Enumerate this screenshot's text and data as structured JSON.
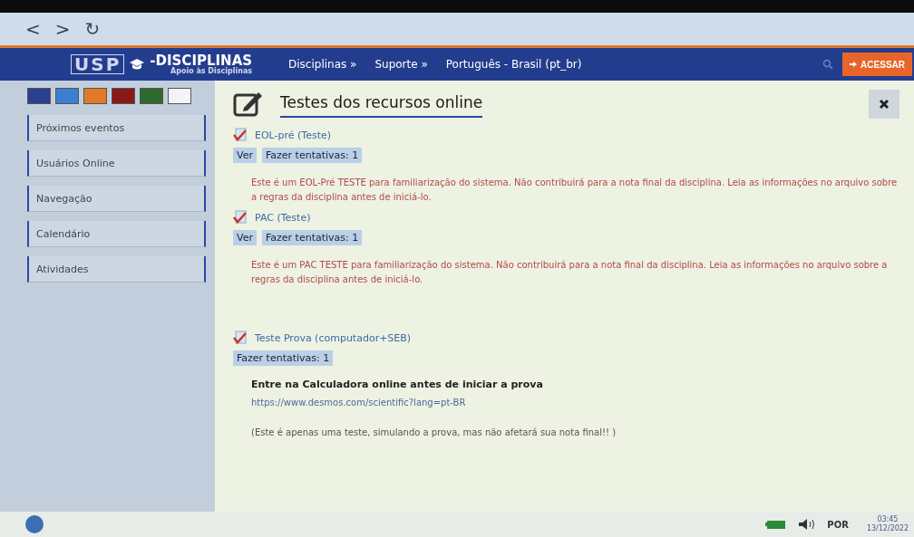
{
  "browser": {
    "nav": [
      "<",
      ">",
      "↻"
    ]
  },
  "header": {
    "logo": "USP",
    "brand": "-DISCIPLINAS",
    "tagline": "Apoio às Disciplinas",
    "menu": [
      "Disciplinas »",
      "Suporte »",
      "Português - Brasil (pt_br)"
    ],
    "login": "ACESSAR"
  },
  "sidebar": {
    "blocks": [
      {
        "label": "Próximos eventos"
      },
      {
        "label": "Usuários Online"
      },
      {
        "label": "Navegação"
      },
      {
        "label": "Calendário"
      },
      {
        "label": "Atividades"
      }
    ]
  },
  "section": {
    "title": "Testes dos recursos online",
    "activities": [
      {
        "name": "EOL-pré (Teste)",
        "buttons": [
          "Ver",
          "Fazer tentativas: 1"
        ],
        "details": [
          {
            "kind": "warning",
            "text": "Este é um EOL-Pré TESTE para familiarização do sistema. Não contribuirá para a nota final da disciplina. Leia as informações no arquivo sobre a regras da disciplina antes de iniciá-lo."
          }
        ]
      },
      {
        "name": "PAC (Teste)",
        "buttons": [
          "Ver",
          "Fazer tentativas: 1"
        ],
        "details": [
          {
            "kind": "warning",
            "text": "Este é um PAC TESTE para familiarização do sistema. Não contribuirá para a nota final da disciplina. Leia as informações no arquivo sobre a regras da disciplina antes de iniciá-lo."
          }
        ]
      },
      {
        "name": "Teste Prova (computador+SEB)",
        "buttons": [
          "Fazer tentativas: 1"
        ],
        "details": [
          {
            "kind": "heading",
            "text": "Entre na Calculadora online antes de iniciar a prova"
          },
          {
            "kind": "link",
            "text": "https://www.desmos.com/scientific?lang=pt-BR"
          },
          {
            "kind": "note",
            "text": "(Este é apenas uma teste, simulando a prova, mas não afetará sua nota final!! )"
          }
        ]
      }
    ]
  },
  "taskbar": {
    "language": "POR",
    "time": "03:45",
    "date": "13/12/2022"
  }
}
